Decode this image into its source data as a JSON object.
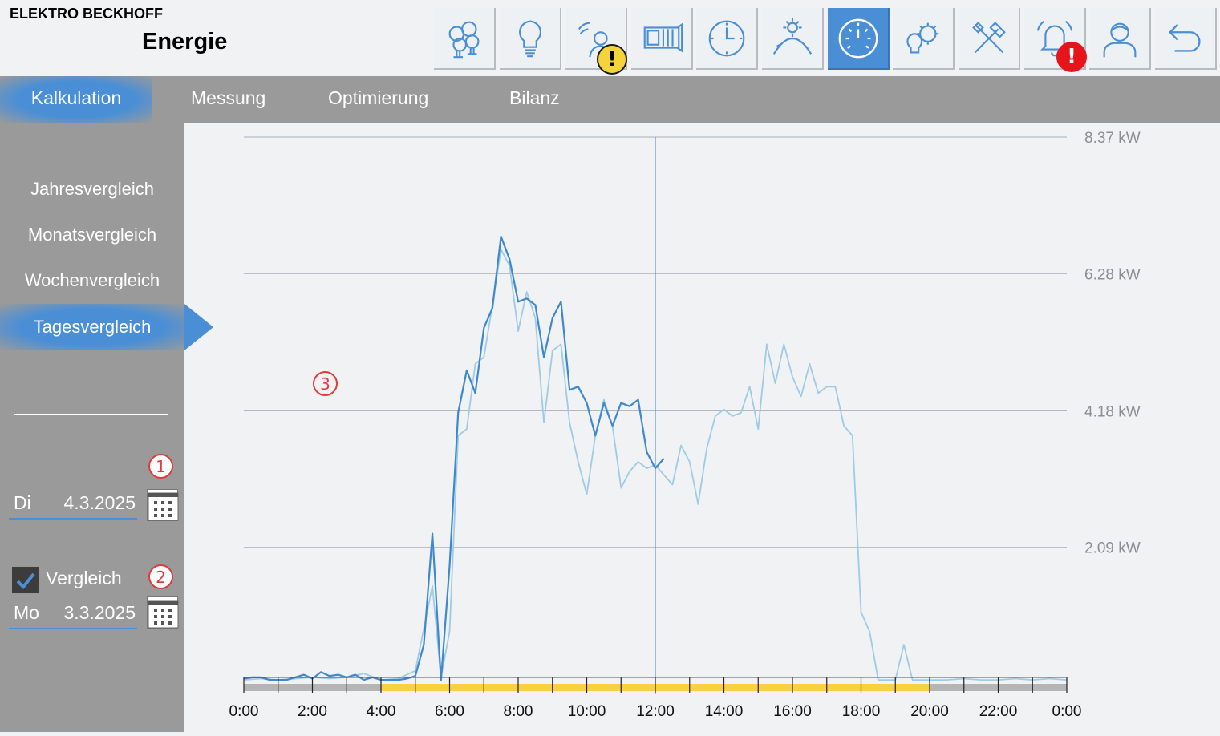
{
  "header": {
    "company": "ELEKTRO BECKHOFF",
    "title": "Energie"
  },
  "toolbar": {
    "icons": [
      "bulbs-icon",
      "bulb-icon",
      "presence-icon",
      "blinds-icon",
      "clock-icon",
      "sun-weather-icon",
      "gauge-icon",
      "gear-bulb-icon",
      "tools-icon",
      "alarm-bell-icon",
      "user-icon",
      "back-icon"
    ],
    "active": "gauge-icon",
    "warning_badge": "!",
    "alarm_badge": "!"
  },
  "tabs": [
    {
      "label": "Kalkulation",
      "active": true
    },
    {
      "label": "Messung",
      "active": false
    },
    {
      "label": "Optimierung",
      "active": false
    },
    {
      "label": "Bilanz",
      "active": false
    }
  ],
  "sidebar": {
    "items": [
      {
        "label": "Jahresvergleich",
        "active": false
      },
      {
        "label": "Monatsvergleich",
        "active": false
      },
      {
        "label": "Wochenvergleich",
        "active": false
      },
      {
        "label": "Tagesvergleich",
        "active": true
      }
    ],
    "date1": {
      "dow": "Di",
      "date": "4.3.2025",
      "marker": "1"
    },
    "compare": {
      "label": "Vergleich",
      "checked": true,
      "marker": "2"
    },
    "date2": {
      "dow": "Mo",
      "date": "3.3.2025"
    }
  },
  "chart_marker": "3",
  "colors": {
    "accent": "#4a8fd6",
    "series_today": "#3f88cf",
    "series_compare": "#9fcbe6",
    "daylight_bar": "#f7d23e",
    "night_bar": "#b5b5b5"
  },
  "chart_data": {
    "type": "line",
    "ylim": [
      0,
      8.37
    ],
    "yticks": [
      2.09,
      4.18,
      6.28,
      8.37
    ],
    "ytick_labels": [
      "2.09 kW",
      "4.18 kW",
      "6.28 kW",
      "8.37 kW"
    ],
    "xlim": [
      0,
      24
    ],
    "xtick_labels": [
      "0:00",
      "2:00",
      "4:00",
      "6:00",
      "8:00",
      "10:00",
      "12:00",
      "14:00",
      "16:00",
      "18:00",
      "20:00",
      "22:00",
      "0:00"
    ],
    "cursor_hour": 12,
    "daylight_range": [
      4,
      20
    ],
    "series": [
      {
        "key": "today",
        "points": [
          [
            0,
            0.08
          ],
          [
            0.25,
            0.1
          ],
          [
            0.5,
            0.1
          ],
          [
            0.75,
            0.06
          ],
          [
            1,
            0.06
          ],
          [
            1.25,
            0.06
          ],
          [
            1.5,
            0.1
          ],
          [
            1.75,
            0.14
          ],
          [
            2,
            0.08
          ],
          [
            2.25,
            0.18
          ],
          [
            2.5,
            0.12
          ],
          [
            2.75,
            0.14
          ],
          [
            3,
            0.1
          ],
          [
            3.25,
            0.14
          ],
          [
            3.5,
            0.06
          ],
          [
            3.75,
            0.1
          ],
          [
            4,
            0.06
          ],
          [
            4.25,
            0.06
          ],
          [
            4.5,
            0.06
          ],
          [
            4.75,
            0.08
          ],
          [
            5,
            0.12
          ],
          [
            5.25,
            0.6
          ],
          [
            5.5,
            2.3
          ],
          [
            5.75,
            0.05
          ],
          [
            6,
            1.8
          ],
          [
            6.25,
            4.15
          ],
          [
            6.5,
            4.8
          ],
          [
            6.75,
            4.45
          ],
          [
            7,
            5.45
          ],
          [
            7.25,
            5.75
          ],
          [
            7.5,
            6.85
          ],
          [
            7.75,
            6.5
          ],
          [
            8,
            5.85
          ],
          [
            8.25,
            5.9
          ],
          [
            8.5,
            5.8
          ],
          [
            8.75,
            5.0
          ],
          [
            9,
            5.6
          ],
          [
            9.25,
            5.85
          ],
          [
            9.5,
            4.5
          ],
          [
            9.75,
            4.55
          ],
          [
            10,
            4.3
          ],
          [
            10.25,
            3.8
          ],
          [
            10.5,
            4.3
          ],
          [
            10.75,
            3.95
          ],
          [
            11,
            4.3
          ],
          [
            11.25,
            4.25
          ],
          [
            11.5,
            4.35
          ],
          [
            11.75,
            3.55
          ],
          [
            12,
            3.3
          ],
          [
            12.25,
            3.45
          ]
        ]
      },
      {
        "key": "compare",
        "points": [
          [
            0,
            0.06
          ],
          [
            0.5,
            0.08
          ],
          [
            1,
            0.06
          ],
          [
            1.5,
            0.08
          ],
          [
            2,
            0.1
          ],
          [
            2.5,
            0.08
          ],
          [
            3,
            0.1
          ],
          [
            3.5,
            0.16
          ],
          [
            4,
            0.06
          ],
          [
            4.5,
            0.08
          ],
          [
            5,
            0.2
          ],
          [
            5.5,
            1.5
          ],
          [
            5.75,
            0.1
          ],
          [
            6,
            0.8
          ],
          [
            6.25,
            3.8
          ],
          [
            6.5,
            3.9
          ],
          [
            6.75,
            4.9
          ],
          [
            7,
            5.0
          ],
          [
            7.25,
            5.8
          ],
          [
            7.5,
            6.65
          ],
          [
            7.75,
            6.4
          ],
          [
            8,
            5.4
          ],
          [
            8.25,
            6.0
          ],
          [
            8.5,
            5.6
          ],
          [
            8.75,
            4.0
          ],
          [
            9,
            5.1
          ],
          [
            9.25,
            5.2
          ],
          [
            9.5,
            4.0
          ],
          [
            9.75,
            3.4
          ],
          [
            10,
            2.9
          ],
          [
            10.25,
            3.8
          ],
          [
            10.5,
            4.35
          ],
          [
            10.75,
            3.95
          ],
          [
            11,
            3.0
          ],
          [
            11.25,
            3.25
          ],
          [
            11.5,
            3.4
          ],
          [
            11.75,
            3.3
          ],
          [
            12,
            3.35
          ],
          [
            12.25,
            3.2
          ],
          [
            12.5,
            3.05
          ],
          [
            12.75,
            3.65
          ],
          [
            13,
            3.4
          ],
          [
            13.25,
            2.75
          ],
          [
            13.5,
            3.6
          ],
          [
            13.75,
            4.1
          ],
          [
            14,
            4.2
          ],
          [
            14.25,
            4.1
          ],
          [
            14.5,
            4.15
          ],
          [
            14.75,
            4.55
          ],
          [
            15,
            3.9
          ],
          [
            15.25,
            5.2
          ],
          [
            15.5,
            4.6
          ],
          [
            15.75,
            5.2
          ],
          [
            16,
            4.7
          ],
          [
            16.25,
            4.4
          ],
          [
            16.5,
            4.9
          ],
          [
            16.75,
            4.45
          ],
          [
            17,
            4.55
          ],
          [
            17.25,
            4.55
          ],
          [
            17.5,
            3.95
          ],
          [
            17.75,
            3.8
          ],
          [
            18,
            1.1
          ],
          [
            18.25,
            0.8
          ],
          [
            18.5,
            0.06
          ],
          [
            18.75,
            0.06
          ],
          [
            19,
            0.06
          ],
          [
            19.25,
            0.6
          ],
          [
            19.5,
            0.06
          ],
          [
            19.75,
            0.06
          ],
          [
            20,
            0.06
          ],
          [
            20.5,
            0.06
          ],
          [
            21,
            0.08
          ],
          [
            21.5,
            0.06
          ],
          [
            22,
            0.06
          ],
          [
            22.5,
            0.08
          ],
          [
            23,
            0.06
          ],
          [
            23.5,
            0.08
          ],
          [
            24,
            0.06
          ]
        ]
      }
    ]
  }
}
